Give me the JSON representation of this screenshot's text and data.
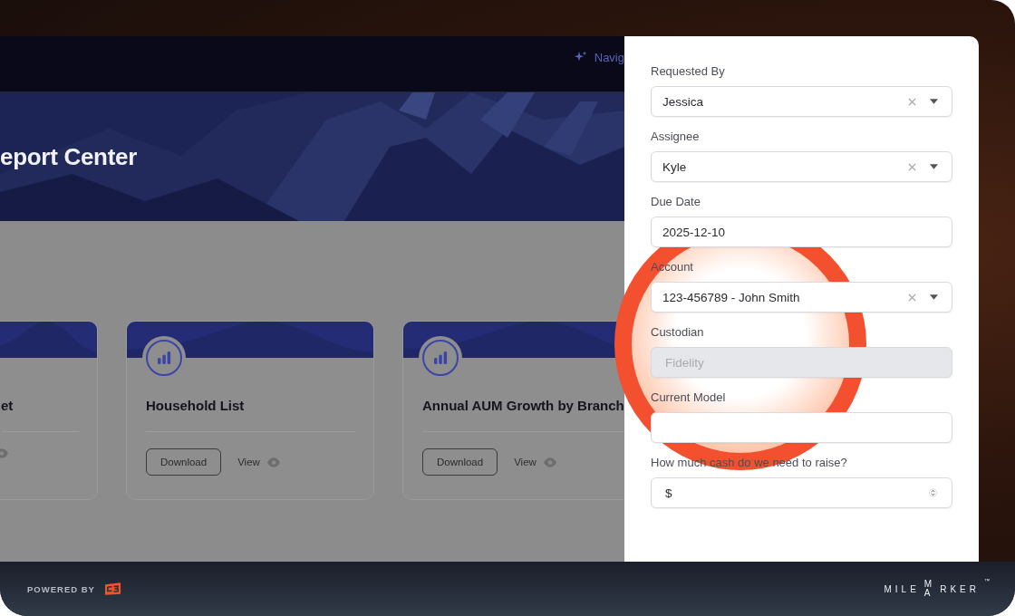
{
  "nav": {
    "item": "Navig"
  },
  "hero": {
    "title": "eport Center"
  },
  "cards": [
    {
      "kind": "partial",
      "title": "et"
    },
    {
      "kind": "full",
      "title": "Household List",
      "download": "Download",
      "view": "View"
    },
    {
      "kind": "full",
      "title": "Annual AUM Growth by Branch",
      "download": "Download",
      "view": "View"
    }
  ],
  "form": {
    "fields": [
      {
        "kind": "select",
        "label": "Requested By",
        "value": "Jessica"
      },
      {
        "kind": "select",
        "label": "Assignee",
        "value": "Kyle"
      },
      {
        "kind": "date",
        "label": "Due Date",
        "value": "2025-12-10"
      },
      {
        "kind": "select",
        "label": "Account",
        "value": "123-456789 - John Smith"
      },
      {
        "kind": "disabled",
        "label": "Custodian",
        "value": "Fidelity"
      },
      {
        "kind": "text",
        "label": "Current Model"
      },
      {
        "kind": "currency",
        "label": "How much cash do we need to raise?",
        "value": "$"
      }
    ]
  },
  "footer": {
    "powered_by": "POWERED BY",
    "logo_parts": [
      "MILE",
      "M",
      "A",
      "RKER"
    ],
    "trademark": "™"
  }
}
